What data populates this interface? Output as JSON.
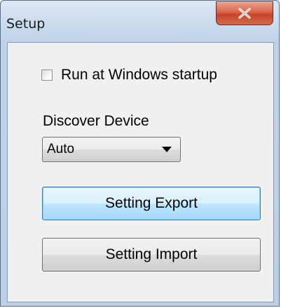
{
  "window": {
    "title": "Setup",
    "close_label": "X"
  },
  "options": {
    "run_at_startup_label": "Run at Windows startup",
    "run_at_startup_checked": false
  },
  "discover": {
    "label": "Discover Device",
    "selected": "Auto"
  },
  "buttons": {
    "export_label": "Setting Export",
    "import_label": "Setting Import"
  },
  "icons": {
    "close": "close-icon",
    "dropdown": "chevron-down-icon"
  },
  "colors": {
    "close_button": "#d9634a",
    "focused_button_border": "#3c7fb1"
  }
}
